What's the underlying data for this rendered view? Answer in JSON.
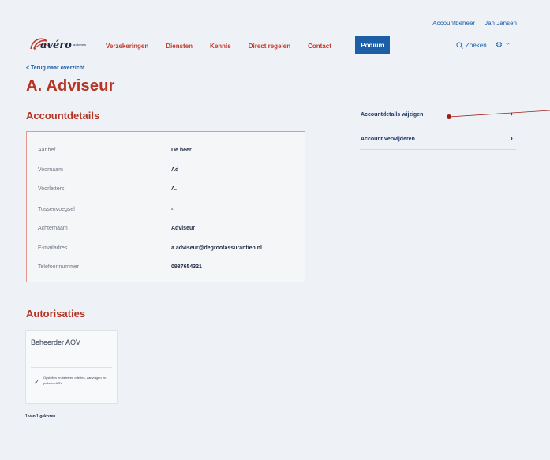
{
  "header": {
    "util_links": [
      "Accountbeheer",
      "Jan Jansen"
    ],
    "logo_text": "avéro",
    "logo_sub": "achmea",
    "nav": [
      "Verzekeringen",
      "Diensten",
      "Kennis",
      "Direct regelen",
      "Contact"
    ],
    "nav_active": "Podium",
    "search_label": "Zoeken"
  },
  "back_link": "< Terug naar overzicht",
  "page_title": "A. Adviseur",
  "account_section": {
    "title": "Accountdetails",
    "rows": [
      {
        "label": "Aanhef",
        "value": "De heer"
      },
      {
        "label": "Voornaam",
        "value": "Ad"
      },
      {
        "label": "Voorletters",
        "value": "A."
      },
      {
        "label": "Tussenvoegsel",
        "value": "-"
      },
      {
        "label": "Achternaam",
        "value": "Adviseur"
      },
      {
        "label": "E-mailadres",
        "value": "a.adviseur@degrootassurantien.nl"
      },
      {
        "label": "Telefoonnummer",
        "value": "0987654321"
      }
    ]
  },
  "actions": [
    {
      "label": "Accountdetails wijzigen"
    },
    {
      "label": "Account verwijderen"
    }
  ],
  "authorisations": {
    "title": "Autorisaties",
    "card_title": "Beheerder AOV",
    "card_desc": "Opstellen en beheren offertes, aanvragen en polissen AOV",
    "count_text": "1 van 1 gekozen"
  },
  "colors": {
    "accent_red": "#b53424",
    "brand_blue": "#1d5fa6",
    "navy": "#1d3568"
  }
}
